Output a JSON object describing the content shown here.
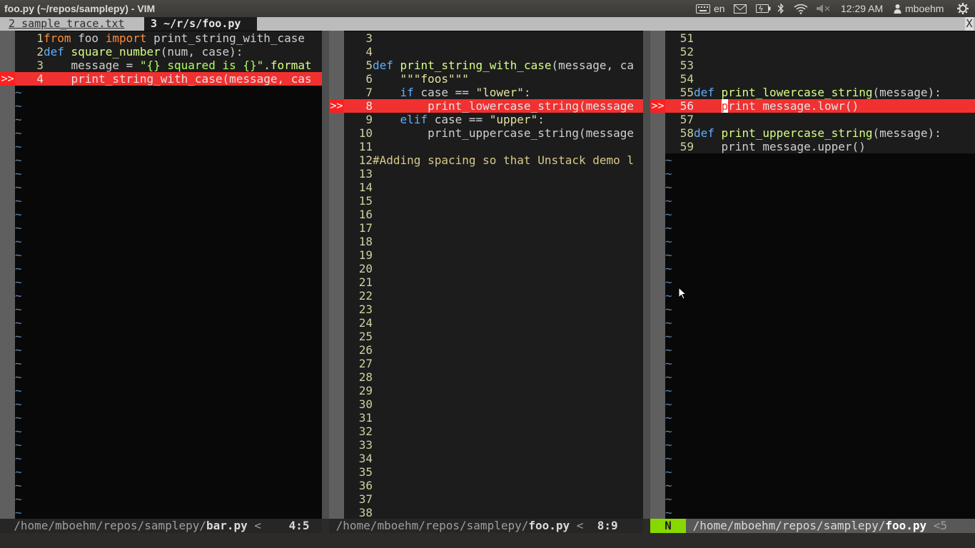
{
  "window": {
    "title": "foo.py (~/repos/samplepy) - VIM"
  },
  "tray": {
    "lang": "en",
    "time": "12:29 AM",
    "user": "mboehm"
  },
  "tabs": [
    {
      "num": "2",
      "label": "sample_trace.txt"
    },
    {
      "num": "3",
      "label": "~/r/s/foo.py"
    }
  ],
  "tab_close": "X",
  "panes": [
    {
      "lines": [
        {
          "n": "1",
          "code": [
            [
              "from",
              "k-import"
            ],
            [
              " foo ",
              ""
            ],
            [
              "import",
              "k-import"
            ],
            [
              " print_string_with_case",
              ""
            ]
          ]
        },
        {
          "n": "2",
          "code": [
            [
              "def",
              "k-def"
            ],
            [
              " ",
              ""
            ],
            [
              "square_number",
              "k-fn"
            ],
            [
              "(num, case):",
              ""
            ]
          ]
        },
        {
          "n": "3",
          "code": [
            [
              "    message = ",
              ""
            ],
            [
              "\"{} squared is {}\"",
              "k-str"
            ],
            [
              ".format",
              "k-fn"
            ]
          ]
        },
        {
          "n": "4",
          "hl": true,
          "code": [
            [
              "    print_string_with_case(message, cas",
              ""
            ]
          ]
        }
      ],
      "sign_line": 3,
      "tildes": 32,
      "status": {
        "path": "/home/mboehm/repos/samplepy/",
        "file": "bar.py",
        "arrow": "<",
        "pos": "4:5"
      }
    },
    {
      "lines": [
        {
          "n": "3",
          "code": []
        },
        {
          "n": "4",
          "code": []
        },
        {
          "n": "5",
          "code": [
            [
              "def",
              "k-def"
            ],
            [
              " ",
              ""
            ],
            [
              "print_string_with_case",
              "k-fn"
            ],
            [
              "(message, ca",
              ""
            ]
          ]
        },
        {
          "n": "6",
          "code": [
            [
              "    ",
              ""
            ],
            [
              "\"\"\"foos\"\"\"",
              "k-strY"
            ]
          ]
        },
        {
          "n": "7",
          "code": [
            [
              "    ",
              ""
            ],
            [
              "if",
              "k-kw"
            ],
            [
              " case == ",
              ""
            ],
            [
              "\"lower\"",
              "k-strY"
            ],
            [
              ":",
              ""
            ]
          ]
        },
        {
          "n": "8",
          "hl": true,
          "code": [
            [
              "        print_lowercase_string(message",
              ""
            ]
          ]
        },
        {
          "n": "9",
          "code": [
            [
              "    ",
              ""
            ],
            [
              "elif",
              "k-kw"
            ],
            [
              " case == ",
              ""
            ],
            [
              "\"upper\"",
              "k-strY"
            ],
            [
              ":",
              ""
            ]
          ]
        },
        {
          "n": "10",
          "code": [
            [
              "        print_uppercase_string(message",
              ""
            ]
          ]
        },
        {
          "n": "11",
          "code": []
        },
        {
          "n": "12",
          "code": [
            [
              "#Adding spacing so that Unstack demo l",
              "k-cmt"
            ]
          ]
        },
        {
          "n": "13",
          "code": []
        },
        {
          "n": "14",
          "code": []
        },
        {
          "n": "15",
          "code": []
        },
        {
          "n": "16",
          "code": []
        },
        {
          "n": "17",
          "code": []
        },
        {
          "n": "18",
          "code": []
        },
        {
          "n": "19",
          "code": []
        },
        {
          "n": "20",
          "code": []
        },
        {
          "n": "21",
          "code": []
        },
        {
          "n": "22",
          "code": []
        },
        {
          "n": "23",
          "code": []
        },
        {
          "n": "24",
          "code": []
        },
        {
          "n": "25",
          "code": []
        },
        {
          "n": "26",
          "code": []
        },
        {
          "n": "27",
          "code": []
        },
        {
          "n": "28",
          "code": []
        },
        {
          "n": "29",
          "code": []
        },
        {
          "n": "30",
          "code": []
        },
        {
          "n": "31",
          "code": []
        },
        {
          "n": "32",
          "code": []
        },
        {
          "n": "33",
          "code": []
        },
        {
          "n": "34",
          "code": []
        },
        {
          "n": "35",
          "code": []
        },
        {
          "n": "36",
          "code": []
        },
        {
          "n": "37",
          "code": []
        },
        {
          "n": "38",
          "code": []
        }
      ],
      "sign_line": 5,
      "tildes": 0,
      "status": {
        "path": "/home/mboehm/repos/samplepy/",
        "file": "foo.py",
        "arrow": "<",
        "pos": "8:9"
      }
    },
    {
      "lines": [
        {
          "n": "51",
          "code": []
        },
        {
          "n": "52",
          "code": []
        },
        {
          "n": "53",
          "code": []
        },
        {
          "n": "54",
          "code": []
        },
        {
          "n": "55",
          "code": [
            [
              "def",
              "k-def"
            ],
            [
              " ",
              ""
            ],
            [
              "print_lowercase_string",
              "k-fn"
            ],
            [
              "(message):",
              ""
            ]
          ]
        },
        {
          "n": "56",
          "hl": true,
          "cursor": true,
          "code": [
            [
              "    ",
              ""
            ],
            [
              "p",
              "cursor"
            ],
            [
              "rint message.lowr()",
              ""
            ]
          ]
        },
        {
          "n": "57",
          "code": []
        },
        {
          "n": "58",
          "code": [
            [
              "def",
              "k-def"
            ],
            [
              " ",
              ""
            ],
            [
              "print_uppercase_string",
              "k-fn"
            ],
            [
              "(message):",
              ""
            ]
          ]
        },
        {
          "n": "59",
          "code": [
            [
              "    print message.upper()",
              ""
            ]
          ]
        }
      ],
      "sign_line": 5,
      "tildes": 27,
      "status": {
        "mode": "N",
        "path": "/home/mboehm/repos/samplepy/",
        "file": "foo.py",
        "arrow": "<5"
      }
    }
  ],
  "sign_text": ">>"
}
